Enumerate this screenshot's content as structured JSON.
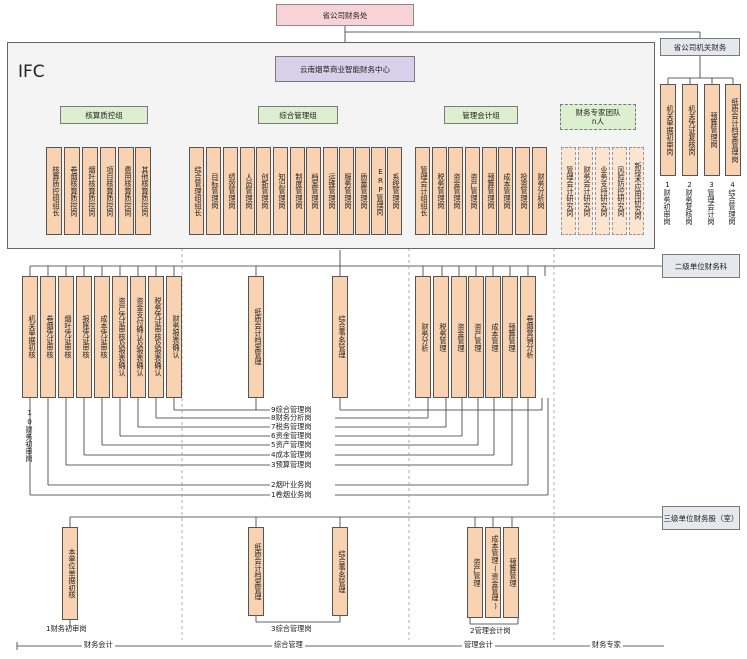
{
  "top": {
    "title": "省公司财务处"
  },
  "ifc": {
    "label": "IFC",
    "center": "云南烟草商业智能财务中心"
  },
  "org": {
    "title": "省公司机关财务",
    "units": [
      "机关单据初审岗",
      "机关凭证复核岗",
      "预算管理岗",
      "纸质会计档案管理岗"
    ],
    "unit_nums": [
      "1财务初审岗",
      "2财务复核岗",
      "3管理会计岗",
      "4综合管理岗"
    ]
  },
  "groups": [
    {
      "name": "核算质控组",
      "posts": [
        "核算质控组组长",
        "卷烟核算质控岗",
        "烟叶核算质控岗",
        "项目核算质控岗",
        "费用核算质控岗",
        "其他核算质控岗"
      ]
    },
    {
      "name": "综合管理组",
      "posts": [
        "综合管理组组长",
        "目标管理岗",
        "绩效管理岗",
        "人员管理岗",
        "创新管理岗",
        "知识管理岗",
        "制度管理岗",
        "档案管理岗",
        "运维管理岗",
        "服务管理岗",
        "质量管理岗",
        "ERP管理岗",
        "系统管理岗"
      ]
    },
    {
      "name": "管理会计组",
      "posts": [
        "管理会计组组长",
        "税务管理岗",
        "资金管理岗",
        "资产管理岗",
        "预算管理岗",
        "成本管理岗",
        "投资管理岗",
        "财务分析岗"
      ]
    },
    {
      "name": "财务专家团队",
      "sub": "n人",
      "posts": [
        "管理会计研究岗",
        "财务会计研究岗",
        "业务支持研究岗",
        "风险防控研究岗",
        "新技术应用研究岗"
      ]
    }
  ],
  "level2": {
    "title": "二级单位财务科",
    "fin_posts": [
      "机关单据初核",
      "卷烟凭证审核",
      "烟叶凭证审核",
      "报账凭证审核",
      "成本凭证审核",
      "资产凭证审核及报表确认",
      "资金支付确认及报表确认",
      "税务凭证审核及报表确认",
      "财务报表确认"
    ],
    "fin_num": "10财务初审岗",
    "comp_posts": [
      "纸质会计档案管理",
      "综合事务管理"
    ],
    "mgmt_posts": [
      "财务分析",
      "税务管理",
      "资金管理",
      "资产管理",
      "成本管理",
      "预算管理",
      "卷烟营销分析"
    ],
    "roles": [
      "9综合管理岗",
      "8财务分析岗",
      "7税务管理岗",
      "6资金管理岗",
      "5资产管理岗",
      "4成本管理岗",
      "3预算管理岗",
      "2烟叶业务岗",
      "1卷烟业务岗"
    ]
  },
  "level3": {
    "title": "三级单位财务股（室）",
    "fin_posts": [
      "本单位单据初核"
    ],
    "fin_label": "1财务初审岗",
    "comp_posts": [
      "纸质会计档案管理",
      "综合事务管理"
    ],
    "comp_label": "3综合管理岗",
    "mgmt_posts": [
      "资产管理",
      "成本管理(资金管理)",
      "预算管理"
    ],
    "mgmt_label": "2管理会计岗"
  },
  "bottom": [
    "财务会计",
    "综合管理",
    "管理会计",
    "财务专家"
  ]
}
